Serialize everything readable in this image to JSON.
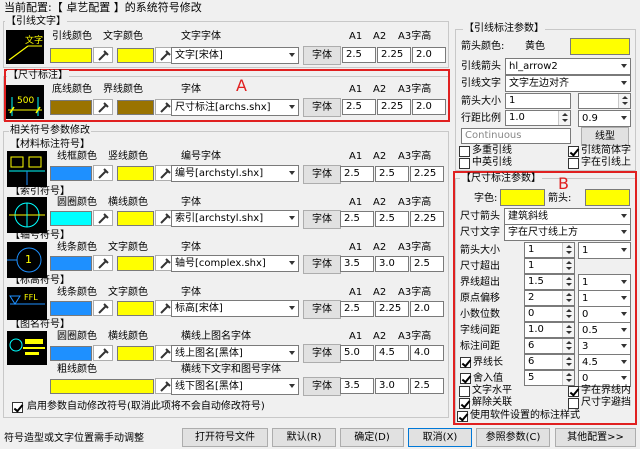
{
  "window_title": "当前配置:【 卓艺配置 】的系统符号修改",
  "colors": {
    "yellow": "#ffff00",
    "brown": "#9a7300",
    "blue": "#1e90ff",
    "cyan": "#00ffff",
    "red": "#e02020"
  },
  "common": {
    "line_color": "引线颜色",
    "text_color": "文字颜色",
    "text_font": "文字字体",
    "font_btn": "字体",
    "a1": "A1",
    "a2": "A2",
    "a3": "A3字高",
    "sub": "字体"
  },
  "leader_text": {
    "title": "【引线文字】",
    "font": "文字[宋体]",
    "a1": "2.5",
    "a2": "2.25",
    "a3": "2.0",
    "preview": "文字"
  },
  "dim_mark": {
    "title": "【尺寸标注】",
    "base_color": "底线颜色",
    "bound_color": "界线颜色",
    "font": "尺寸标注[archs.shx]",
    "a1": "2.5",
    "a2": "2.25",
    "a3": "2.0",
    "preview": "500",
    "annot": "A"
  },
  "related_title": "相关符号参数修改",
  "material": {
    "title": "【材料标注符号】",
    "c1": "线框颜色",
    "c2": "竖线颜色",
    "label": "编号字体",
    "font": "编号[archstyl.shx]",
    "a1": "2.5",
    "a2": "2.5",
    "a3": "2.25"
  },
  "index": {
    "title": "【索引符号】",
    "c1": "圆圈颜色",
    "c2": "横线颜色",
    "font": "索引[archstyl.shx]",
    "a1": "2.5",
    "a2": "2.5",
    "a3": "2.25"
  },
  "axis": {
    "title": "【轴号符号】",
    "c1": "线条颜色",
    "c2": "文字颜色",
    "font": "轴号[complex.shx]",
    "a1": "3.5",
    "a2": "3.0",
    "a3": "2.5",
    "preview": "1"
  },
  "elevation": {
    "title": "【标高符号】",
    "c1": "线条颜色",
    "c2": "文字颜色",
    "font": "标高[宋体]",
    "a1": "2.5",
    "a2": "2.25",
    "a3": "2.0",
    "preview": "FFL"
  },
  "drawname": {
    "title": "【图名符号】",
    "c1": "圆圈颜色",
    "c2": "横线颜色",
    "upper_label": "横线上图名字体",
    "upper_font": "线上图名[黑体]",
    "u1": "5.0",
    "u2": "4.5",
    "u3": "4.0",
    "thick": "粗线颜色",
    "lower_label": "横线下文字和图号字体",
    "lower_font": "线下图名[黑体]",
    "l1": "3.5",
    "l2": "3.0",
    "l3": "2.5"
  },
  "auto_modify": "启用参数自动修改符号(取消此项将不会自动修改符号)",
  "leader_params": {
    "title": "【引线标注参数】",
    "arrow_color": "箭头颜色:",
    "arrow_color_name": "黄色",
    "lead_arrow": "引线箭头",
    "lead_arrow_val": "hl_arrow2",
    "lead_text": "引线文字",
    "lead_text_val": "文字左边对齐",
    "arrow_size": "箭头大小",
    "arrow_size_val": "1",
    "line_ratio": "行距比例",
    "line_ratio_v1": "1.0",
    "line_ratio_v2": "0.9",
    "linetype": "Continuous",
    "linetype_btn": "线型",
    "cb_multi": "多重引线",
    "cb_chinese": "中英引线",
    "cb_simple": "引线简体字",
    "cb_right": "字在引线上"
  },
  "dim_params": {
    "title": "【尺寸标注参数】",
    "annot": "B",
    "text_color": "字色:",
    "arrow_color": "箭头:",
    "dim_arrow": "尺寸箭头",
    "dim_arrow_val": "建筑斜线",
    "dim_text": "尺寸文字",
    "dim_text_val": "字在尺寸线上方",
    "rows": [
      {
        "label": "箭头大小",
        "v1": "1",
        "v2": "1"
      },
      {
        "label": "尺寸超出",
        "v1": "1",
        "v2": ""
      },
      {
        "label": "界线超出",
        "v1": "1.5",
        "v2": "1"
      },
      {
        "label": "原点偏移",
        "v1": "2",
        "v2": "1"
      },
      {
        "label": "小数位数",
        "v1": "0",
        "v2": "0"
      },
      {
        "label": "字线间距",
        "v1": "1.0",
        "v2": "0.5"
      },
      {
        "label": "标注间距",
        "v1": "6",
        "v2": "3"
      },
      {
        "label": "界线长",
        "v1": "6",
        "v2": "4.5"
      },
      {
        "label": "舍入值",
        "v1": "5",
        "v2": "0"
      }
    ],
    "cb_text_h": "文字水平",
    "cb_in": "字在界线内",
    "cb_unlink": "解除关联",
    "cb_size": "尺寸字避挡",
    "cb_use": "使用软件设置的标注样式"
  },
  "footer": {
    "hint": "符号造型或文字位置需手动调整",
    "open": "打开符号文件",
    "default": "默认(R)",
    "ok": "确定(D)",
    "cancel": "取消(X)",
    "ref": "参照参数(C)",
    "other": "其他配置>>"
  }
}
